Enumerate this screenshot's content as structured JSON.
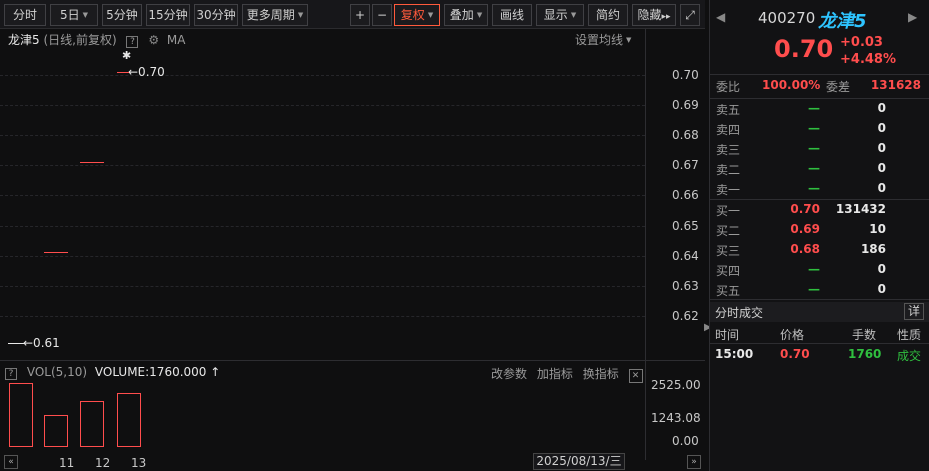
{
  "toolbar": {
    "tabs": [
      "分时",
      "5日",
      "5分钟",
      "15分钟",
      "30分钟",
      "更多周期"
    ],
    "plus": "+",
    "minus": "−",
    "restore": "复权",
    "overlay": "叠加",
    "draw": "画线",
    "display": "显示",
    "simple": "简约",
    "hide": "隐藏",
    "hide_arrow": "▸▸",
    "fullscreen": "⤢"
  },
  "chart": {
    "title": "龙津5",
    "subtitle": "(日线,前复权)",
    "help": "?",
    "ma": "MA",
    "ma_settings": "设置均线",
    "yticks": [
      "0.70",
      "0.69",
      "0.68",
      "0.67",
      "0.66",
      "0.65",
      "0.64",
      "0.63",
      "0.62"
    ],
    "high_annotation": "←0.70",
    "low_annotation": "←0.61",
    "star": "✱"
  },
  "volume": {
    "help": "?",
    "indicator": "VOL(5,10)",
    "value_label": "VOLUME:1760.000",
    "arrow": "↑",
    "edit_params": "改参数",
    "add_indicator": "加指标",
    "switch_indicator": "换指标",
    "close": "✕",
    "yticks": [
      "2525.00",
      "1243.08",
      "0.00"
    ],
    "xticks": [
      "11",
      "12",
      "13"
    ],
    "date": "2025/08/13/三",
    "bars": [
      2525,
      1243,
      1830,
      2140
    ]
  },
  "quote": {
    "code": "400270",
    "name": "龙津5",
    "price": "0.70",
    "change": "+0.03",
    "change_pct": "+4.48%",
    "weibi_label": "委比",
    "weibi": "100.00%",
    "weicha_label": "委差",
    "weicha": "131628",
    "asks": [
      {
        "label": "卖五",
        "price": "—",
        "vol": "0"
      },
      {
        "label": "卖四",
        "price": "—",
        "vol": "0"
      },
      {
        "label": "卖三",
        "price": "—",
        "vol": "0"
      },
      {
        "label": "卖二",
        "price": "—",
        "vol": "0"
      },
      {
        "label": "卖一",
        "price": "—",
        "vol": "0"
      }
    ],
    "bids": [
      {
        "label": "买一",
        "price": "0.70",
        "vol": "131432"
      },
      {
        "label": "买二",
        "price": "0.69",
        "vol": "10"
      },
      {
        "label": "买三",
        "price": "0.68",
        "vol": "186"
      },
      {
        "label": "买四",
        "price": "—",
        "vol": "0"
      },
      {
        "label": "买五",
        "price": "—",
        "vol": "0"
      }
    ]
  },
  "trades": {
    "title": "分时成交",
    "detail": "详",
    "headers": [
      "时间",
      "价格",
      "手数",
      "性质"
    ],
    "rows": [
      {
        "time": "15:00",
        "price": "0.70",
        "qty": "1760",
        "type": "成交"
      }
    ]
  },
  "colors": {
    "up": "#ff4d4d",
    "down": "#2fbf3f",
    "accent": "#ff5a3c"
  }
}
